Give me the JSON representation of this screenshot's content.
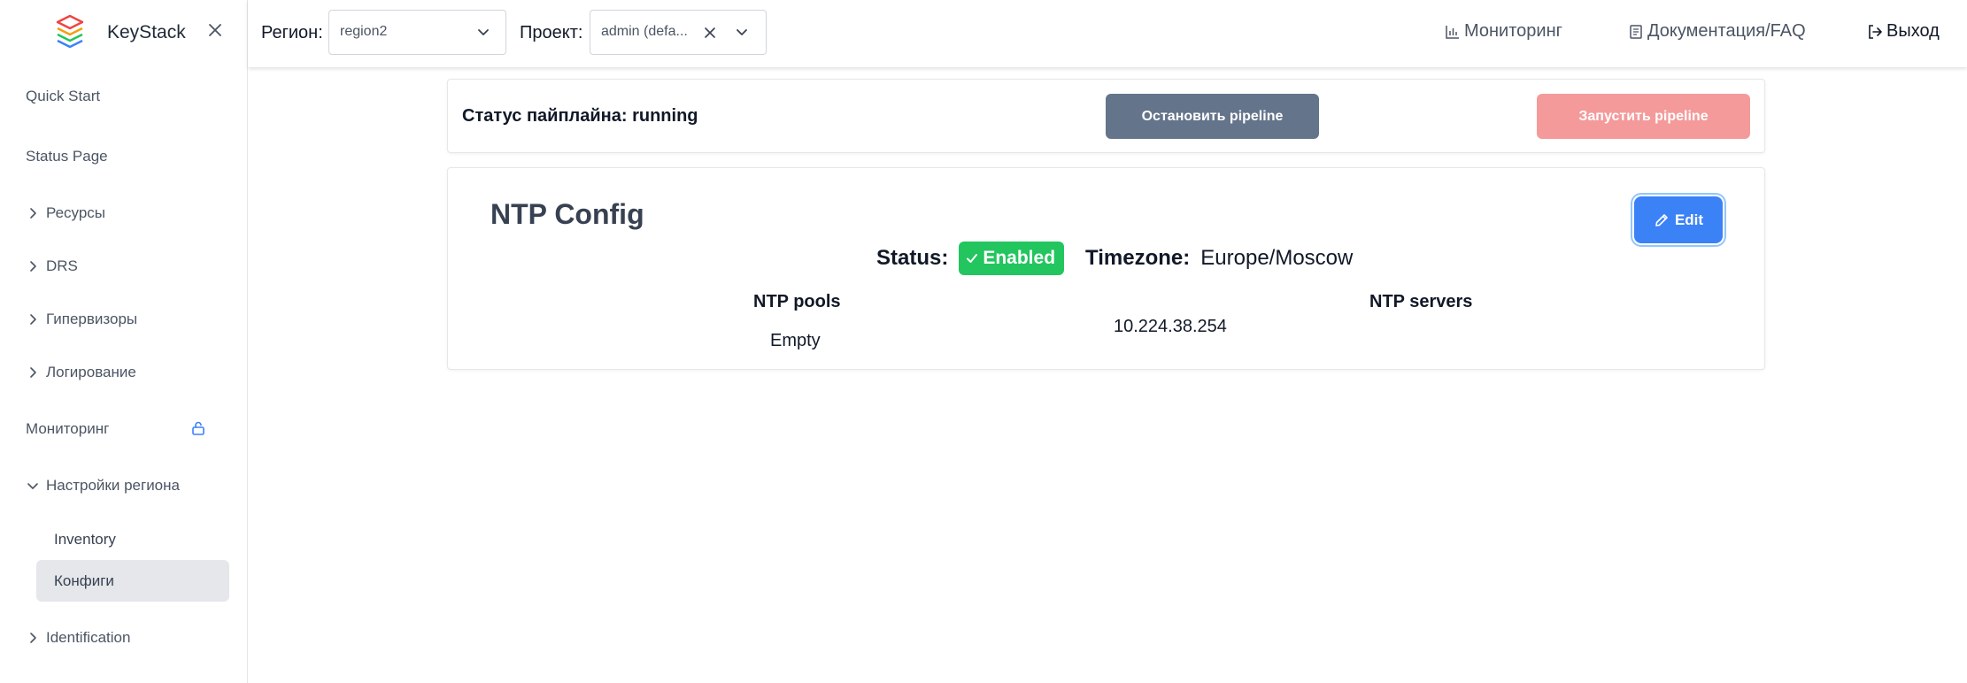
{
  "sidebar": {
    "app_name": "KeyStack",
    "items": [
      {
        "label": "Quick Start"
      },
      {
        "label": "Status Page"
      },
      {
        "label": "Ресурсы"
      },
      {
        "label": "DRS"
      },
      {
        "label": "Гипервизоры"
      },
      {
        "label": "Логирование"
      },
      {
        "label": "Мониторинг"
      },
      {
        "label": "Настройки региона"
      },
      {
        "label": "Identification"
      }
    ],
    "sub_items": [
      {
        "label": "Inventory"
      },
      {
        "label": "Конфиги"
      }
    ]
  },
  "topbar": {
    "region_label": "Регион:",
    "region_value": "region2",
    "project_label": "Проект:",
    "project_value": "admin (defa...",
    "monitoring_link": "Мониторинг",
    "docs_link": "Документация/FAQ",
    "logout_link": "Выход"
  },
  "pipeline": {
    "status_text": "Статус пайплайна: running",
    "stop_label": "Остановить pipeline",
    "start_label": "Запустить pipeline"
  },
  "ntp": {
    "title": "NTP Config",
    "edit_label": "Edit",
    "status_label": "Status:",
    "status_value": "Enabled",
    "timezone_label": "Timezone:",
    "timezone_value": "Europe/Moscow",
    "pools_header": "NTP pools",
    "pools_value": "Empty",
    "servers_header": "NTP servers",
    "servers_value": "10.224.38.254"
  },
  "colors": {
    "stop_button": "#64748b",
    "start_button": "#f49a9a",
    "edit_button": "#3b82f6",
    "enabled_badge": "#22c55e",
    "active_nav": "#e5e7eb"
  }
}
